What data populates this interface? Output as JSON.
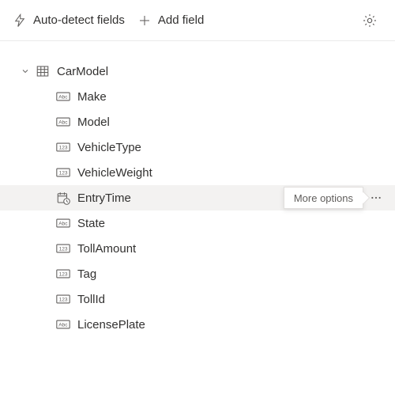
{
  "toolbar": {
    "auto_detect_label": "Auto-detect fields",
    "add_field_label": "Add field"
  },
  "tooltip": {
    "more_options": "More options"
  },
  "table": {
    "name": "CarModel",
    "expanded": true
  },
  "fields": [
    {
      "name": "Make",
      "type": "text",
      "hovered": false
    },
    {
      "name": "Model",
      "type": "text",
      "hovered": false
    },
    {
      "name": "VehicleType",
      "type": "number",
      "hovered": false
    },
    {
      "name": "VehicleWeight",
      "type": "number",
      "hovered": false
    },
    {
      "name": "EntryTime",
      "type": "datetime",
      "hovered": true
    },
    {
      "name": "State",
      "type": "text",
      "hovered": false
    },
    {
      "name": "TollAmount",
      "type": "number",
      "hovered": false
    },
    {
      "name": "Tag",
      "type": "number",
      "hovered": false
    },
    {
      "name": "TollId",
      "type": "number",
      "hovered": false
    },
    {
      "name": "LicensePlate",
      "type": "text",
      "hovered": false
    }
  ]
}
